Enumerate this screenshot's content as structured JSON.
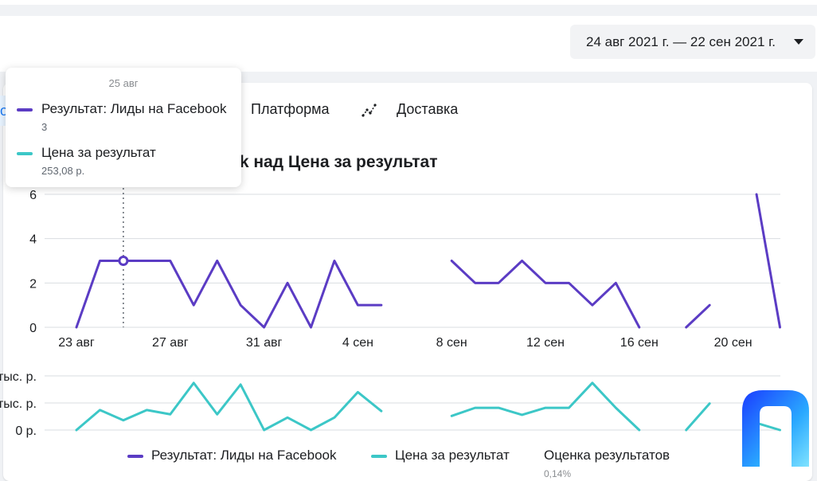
{
  "header": {
    "date_range": "24 авг 2021 г. — 22 сен 2021 г."
  },
  "tabs": {
    "left_stub": "о",
    "platform": "Платформа",
    "delivery": "Доставка"
  },
  "tooltip": {
    "date": "25 авг",
    "rows": [
      {
        "label": "Результат: Лиды на Facebook",
        "value": "3"
      },
      {
        "label": "Цена за результат",
        "value": "253,08 р."
      }
    ]
  },
  "legend": [
    {
      "label": "Результат: Лиды на Facebook"
    },
    {
      "label": "Цена за результат"
    },
    {
      "label": "Оценка результатов",
      "sub": "0,14%"
    }
  ],
  "colors": {
    "results": "#5b3cc4",
    "cost": "#3cc7c7",
    "grid": "#dadde1",
    "cursor": "#606770"
  },
  "chart_data": {
    "type": "line",
    "title": "ok над Цена за результат",
    "x": [
      "23 авг",
      "24 авг",
      "25 авг",
      "26 авг",
      "27 авг",
      "28 авг",
      "29 авг",
      "30 авг",
      "31 авг",
      "1 сен",
      "2 сен",
      "3 сен",
      "4 сен",
      "5 сен",
      "6 сен",
      "7 сен",
      "8 сен",
      "9 сен",
      "10 сен",
      "11 сен",
      "12 сен",
      "13 сен",
      "14 сен",
      "15 сен",
      "16 сен",
      "17 сен",
      "18 сен",
      "19 сен",
      "20 сен",
      "21 сен",
      "22 сен"
    ],
    "x_ticks": [
      "23 авг",
      "27 авг",
      "31 авг",
      "4 сен",
      "8 сен",
      "12 сен",
      "16 сен",
      "20 сен"
    ],
    "series": [
      {
        "name": "Результат: Лиды на Facebook",
        "values": [
          0,
          3,
          3,
          3,
          3,
          1,
          3,
          1,
          0,
          2,
          0,
          3,
          1,
          1,
          null,
          null,
          3,
          2,
          2,
          3,
          2,
          2,
          1,
          2,
          0,
          null,
          0,
          1,
          null,
          6,
          0
        ],
        "ylim": [
          0,
          6
        ],
        "y_ticks": [
          "0",
          "2",
          "4",
          "6"
        ]
      },
      {
        "name": "Цена за результат",
        "values": [
          0,
          0.37,
          0.18,
          0.37,
          0.29,
          0.87,
          0.29,
          0.84,
          0,
          0.23,
          0,
          0.23,
          0.7,
          0.35,
          null,
          null,
          0.26,
          0.41,
          0.41,
          0.28,
          0.41,
          0.41,
          0.87,
          0.41,
          0,
          null,
          0,
          0.49,
          null,
          0.13,
          0
        ],
        "y_ticks": [
          "0 р.",
          "тыс. р.",
          "тыс. р."
        ]
      }
    ],
    "cursor_x": "25 авг",
    "grid": true,
    "legend_position": "bottom"
  }
}
